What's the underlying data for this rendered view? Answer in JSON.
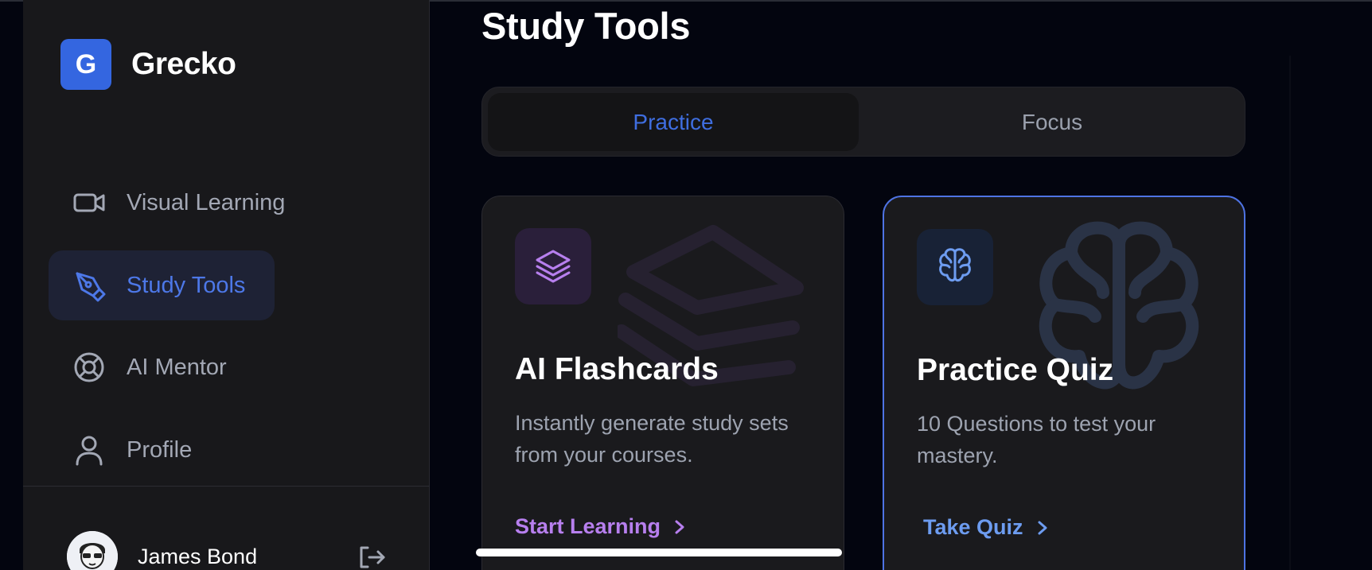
{
  "brand": {
    "logo_letter": "G",
    "name": "Grecko",
    "accent": "#3466e0"
  },
  "sidebar": {
    "items": [
      {
        "label": "Visual Learning",
        "icon": "video-camera-icon",
        "active": false
      },
      {
        "label": "Study Tools",
        "icon": "pen-tool-icon",
        "active": true
      },
      {
        "label": "AI Mentor",
        "icon": "lifebuoy-icon",
        "active": false
      },
      {
        "label": "Profile",
        "icon": "user-icon",
        "active": false
      }
    ],
    "user": {
      "name": "James Bond",
      "avatar": "cartoon-avatar",
      "logout_icon": "logout-icon"
    }
  },
  "main": {
    "title": "Study Tools",
    "tabs": [
      {
        "label": "Practice",
        "active": true
      },
      {
        "label": "Focus",
        "active": false
      }
    ],
    "cards": [
      {
        "title": "AI Flashcards",
        "description": "Instantly generate study sets from your courses.",
        "cta": "Start Learning",
        "icon": "layers-icon",
        "accent": "#b77fee"
      },
      {
        "title": "Practice Quiz",
        "description": "10 Questions to test your mastery.",
        "cta": "Take Quiz",
        "icon": "brain-icon",
        "accent": "#6d9cf0"
      }
    ]
  }
}
